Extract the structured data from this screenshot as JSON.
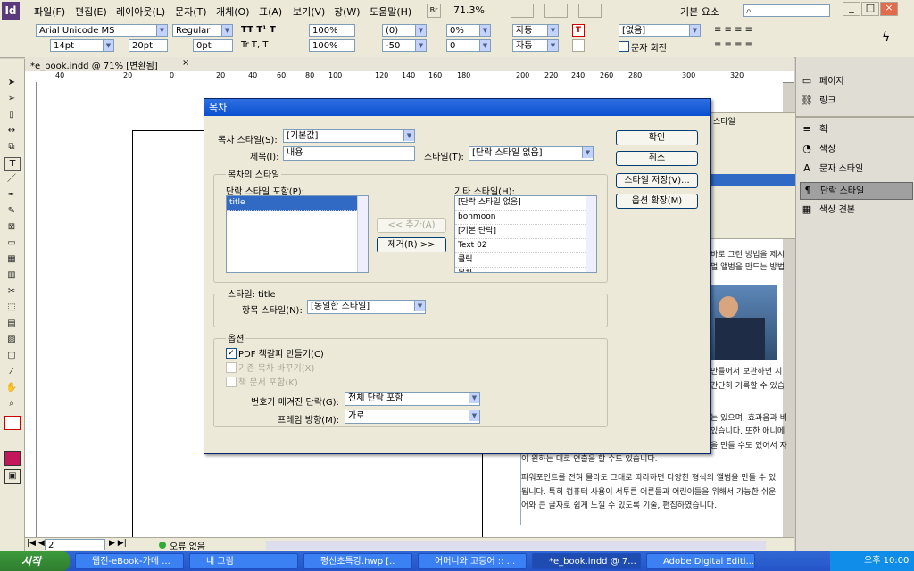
{
  "app": {
    "logo": "Id"
  },
  "menu": [
    "파일(F)",
    "편집(E)",
    "레이아웃(L)",
    "문자(T)",
    "개체(O)",
    "표(A)",
    "보기(V)",
    "창(W)",
    "도움말(H)"
  ],
  "zoom": "71.3%",
  "workspace": "기본 요소",
  "control": {
    "font": "Arial Unicode MS",
    "style": "Regular",
    "size": "14pt",
    "leading": "20pt",
    "baseline": "0pt",
    "hscale": "100%",
    "vscale": "100%",
    "kerning": "(0)",
    "tracking": "-50",
    "skew": "0%",
    "rotate": "0",
    "auto1": "자동",
    "auto2": "자동",
    "lang": "[없음]",
    "rotate_char": "문자 회전"
  },
  "document": {
    "tab": "*e_book.indd @ 71% [변환됨]",
    "ruler": [
      "40",
      "20",
      "0",
      "20",
      "40",
      "60",
      "80",
      "100",
      "120",
      "140",
      "160",
      "180",
      "200",
      "220",
      "240",
      "260",
      "280",
      "300",
      "320"
    ],
    "page": "2",
    "errors": "오류 없음",
    "behind_text": [
      "바로 그런 방법을 제시",
      "멀 앨범을 만드는 방법",
      "만들어서 보관하면 지",
      "간단히 기록할 수 있습",
      "는 있으며, 효과음과 비",
      "있습니다. 또한 애니메",
      "을 만들 수도 있어서 자",
      "이 원하는 대로 연출을 할 수도 있습니다.",
      "파워포인트를 전혀 몰라도 그대로 따라하면 다양한 형식의 앨범을 만들 수 있",
      "됩니다. 특히 컴퓨터 사용이 서투른 어른들과 어린이들을 위해서 가능한 쉬운",
      "어와 큰 글자로 쉽게 느낄 수 있도록 기술, 편집하였습니다."
    ]
  },
  "right_panel": {
    "top": [
      {
        "icon": "page-icon",
        "label": "페이지"
      },
      {
        "icon": "link-icon",
        "label": "링크"
      }
    ],
    "bottom": [
      {
        "icon": "stroke-icon",
        "label": "획"
      },
      {
        "icon": "swatch-icon",
        "label": "색상"
      },
      {
        "icon": "char-style-icon",
        "label": "문자 스타일"
      },
      {
        "icon": "para-style-icon",
        "label": "단락 스타일"
      },
      {
        "icon": "color-swatch-icon",
        "label": "색상 견본"
      }
    ],
    "behind_tab": "스타일"
  },
  "dialog": {
    "title": "목차",
    "toc_style_label": "목차 스타일(S):",
    "toc_style_value": "[기본값]",
    "title_label": "제목(I):",
    "title_value": "내용",
    "style_label": "스타일(T):",
    "style_value": "[단락 스타일 없음]",
    "group_styles": "목차의 스타일",
    "include_label": "단락 스타일 포함(P):",
    "include_items": [
      "title"
    ],
    "add_btn": "<< 추가(A)",
    "remove_btn": "제거(R) >>",
    "other_label": "기타 스타일(H):",
    "other_items": [
      "[단락 스타일 없음]",
      "bonmoon",
      "[기본 단락]",
      "Text 02",
      "클릭",
      "목차"
    ],
    "style_sub_label": "스타일: title",
    "entry_label": "항목 스타일(N):",
    "entry_value": "[동일한 스타일]",
    "options_label": "옵션",
    "opt_pdf": "PDF 책갈피 만들기(C)",
    "opt_replace": "기존 목차 바꾸기(X)",
    "opt_book": "책 문서 포함(K)",
    "numbered_label": "번호가 매겨진 단락(G):",
    "numbered_value": "전체 단락 포함",
    "frame_label": "프레임 방향(M):",
    "frame_value": "가로",
    "ok": "확인",
    "cancel": "취소",
    "save_style": "스타일 저장(V)...",
    "more_options": "옵션 확장(M)"
  },
  "taskbar": {
    "start": "시작",
    "tasks": [
      "웹진-eBook-가메 ...",
      "내 그림",
      "평산초특강.hwp [..",
      "어머니와 고등어 :: ...",
      "*e_book.indd @ 7...",
      "Adobe Digital Editi..."
    ],
    "clock": "오후 10:00"
  }
}
